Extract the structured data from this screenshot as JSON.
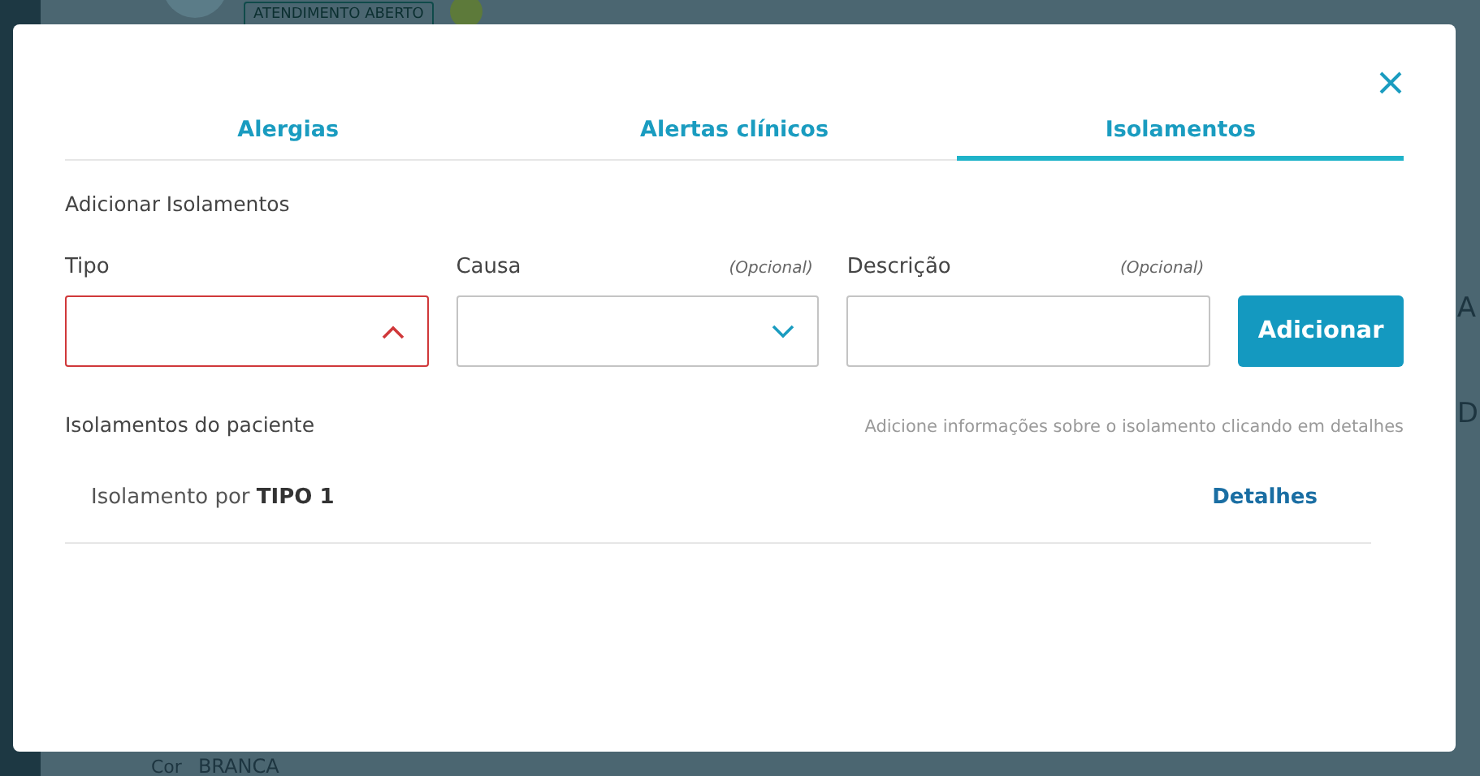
{
  "background": {
    "badge": "ATENDIMENTO ABERTO",
    "edge_texts": [
      "A",
      "D"
    ],
    "footer_label": "Cor",
    "footer_value": "BRANCA"
  },
  "modal": {
    "tabs": [
      {
        "label": "Alergias",
        "selected": false
      },
      {
        "label": "Alertas clínicos",
        "selected": false
      },
      {
        "label": "Isolamentos",
        "selected": true
      }
    ],
    "section_title": "Adicionar Isolamentos",
    "fields": [
      {
        "kind": "select",
        "label": "Tipo",
        "error": true,
        "expanded": true
      },
      {
        "kind": "select",
        "label": "Causa",
        "optional": "(Opcional)",
        "error": false,
        "expanded": false
      },
      {
        "kind": "text",
        "label": "Descrição",
        "optional": "(Opcional)"
      }
    ],
    "add_button": "Adicionar",
    "list_title": "Isolamentos do paciente",
    "list_hint": "Adicione informações sobre o isolamento clicando em detalhes",
    "items": [
      {
        "text": "Isolamento por **TIPO 1**",
        "action": "Detalhes"
      }
    ]
  }
}
